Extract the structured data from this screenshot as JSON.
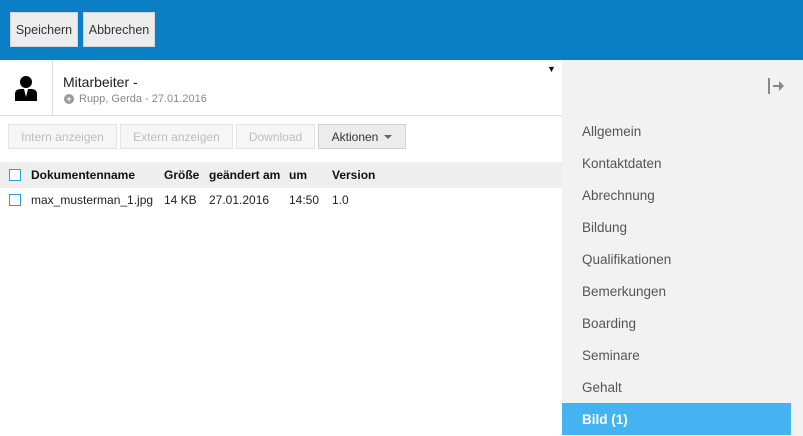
{
  "topbar": {
    "save_label": "Speichern",
    "cancel_label": "Abbrechen",
    "color": "#0a7fc6"
  },
  "header": {
    "title": "Mitarbeiter -",
    "subtitle": "Rupp, Gerda - 27.01.2016",
    "caret": "▼"
  },
  "toolbar": {
    "intern_label": "Intern anzeigen",
    "extern_label": "Extern anzeigen",
    "download_label": "Download",
    "actions_label": "Aktionen"
  },
  "table": {
    "columns": [
      "Dokumentenname",
      "Größe",
      "geändert am",
      "um",
      "Version"
    ],
    "rows": [
      {
        "name": "max_musterman_1.jpg",
        "size": "14 KB",
        "date": "27.01.2016",
        "time": "14:50",
        "version": "1.0"
      }
    ]
  },
  "sidebar": {
    "collapse_icon": "collapse-right-icon",
    "items": [
      {
        "label": "Allgemein"
      },
      {
        "label": "Kontaktdaten"
      },
      {
        "label": "Abrechnung"
      },
      {
        "label": "Bildung"
      },
      {
        "label": "Qualifikationen"
      },
      {
        "label": "Bemerkungen"
      },
      {
        "label": "Boarding"
      },
      {
        "label": "Seminare"
      },
      {
        "label": "Gehalt"
      },
      {
        "label": "Bild (1)",
        "active": true
      }
    ],
    "active_color": "#45b3f2"
  }
}
